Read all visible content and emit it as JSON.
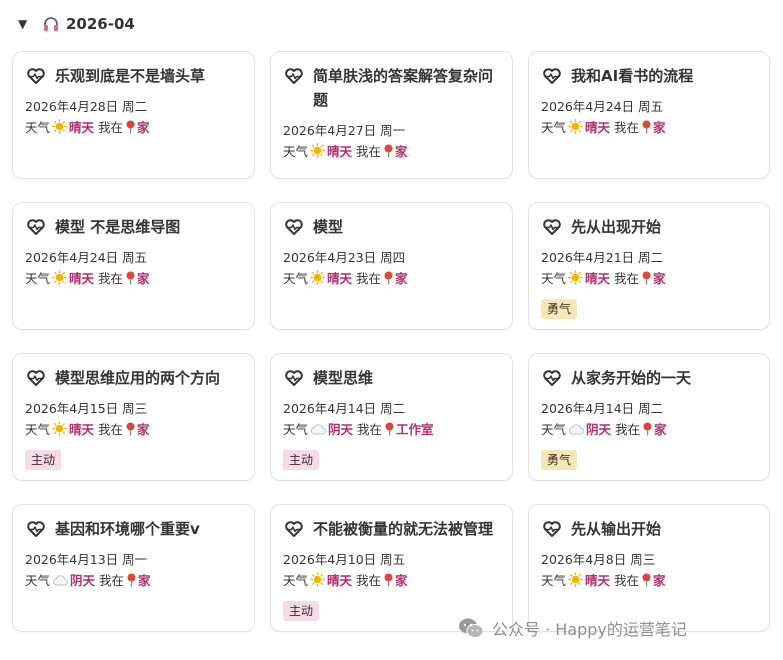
{
  "group": {
    "title": "2026-04",
    "icon": "headphones-icon",
    "toggle": "▼"
  },
  "labels": {
    "weather_prefix": "天气",
    "location_prefix": "我在"
  },
  "colors": {
    "accent": "#b0306e",
    "tag_yellow": "#f4e8b8",
    "tag_pink": "#f5dbe6"
  },
  "cards": [
    {
      "title": "乐观到底是不是墙头草",
      "date": "2026年4月28日 周二",
      "weather": "晴天",
      "weather_icon": "sun-icon",
      "location": "家",
      "tag": ""
    },
    {
      "title": "简单肤浅的答案解答复杂问题",
      "date": "2026年4月27日 周一",
      "weather": "晴天",
      "weather_icon": "sun-icon",
      "location": "家",
      "tag": ""
    },
    {
      "title": "我和AI看书的流程",
      "date": "2026年4月24日 周五",
      "weather": "晴天",
      "weather_icon": "sun-icon",
      "location": "家",
      "tag": ""
    },
    {
      "title": "模型 不是思维导图",
      "date": "2026年4月24日 周五",
      "weather": "晴天",
      "weather_icon": "sun-icon",
      "location": "家",
      "tag": ""
    },
    {
      "title": "模型",
      "date": "2026年4月23日 周四",
      "weather": "晴天",
      "weather_icon": "sun-icon",
      "location": "家",
      "tag": ""
    },
    {
      "title": "先从出现开始",
      "date": "2026年4月21日 周二",
      "weather": "晴天",
      "weather_icon": "sun-icon",
      "location": "家",
      "tag": "勇气",
      "tag_color": "yellow"
    },
    {
      "title": "模型思维应用的两个方向",
      "date": "2026年4月15日 周三",
      "weather": "晴天",
      "weather_icon": "sun-icon",
      "location": "家",
      "tag": "主动",
      "tag_color": "pink"
    },
    {
      "title": "模型思维",
      "date": "2026年4月14日 周二",
      "weather": "阴天",
      "weather_icon": "cloud-icon",
      "location": "工作室",
      "tag": "主动",
      "tag_color": "pink"
    },
    {
      "title": "从家务开始的一天",
      "date": "2026年4月14日 周二",
      "weather": "阴天",
      "weather_icon": "cloud-icon",
      "location": "家",
      "tag": "勇气",
      "tag_color": "yellow"
    },
    {
      "title": "基因和环境哪个重要v",
      "date": "2026年4月13日 周一",
      "weather": "阴天",
      "weather_icon": "cloud-icon",
      "location": "家",
      "tag": ""
    },
    {
      "title": "不能被衡量的就无法被管理",
      "date": "2026年4月10日 周五",
      "weather": "晴天",
      "weather_icon": "sun-icon",
      "location": "家",
      "tag": "主动",
      "tag_color": "pink"
    },
    {
      "title": "先从输出开始",
      "date": "2026年4月8日 周三",
      "weather": "晴天",
      "weather_icon": "sun-icon",
      "location": "家",
      "tag": ""
    }
  ],
  "watermark": {
    "text": "公众号 · Happy的运营笔记",
    "icon": "wechat-icon"
  }
}
